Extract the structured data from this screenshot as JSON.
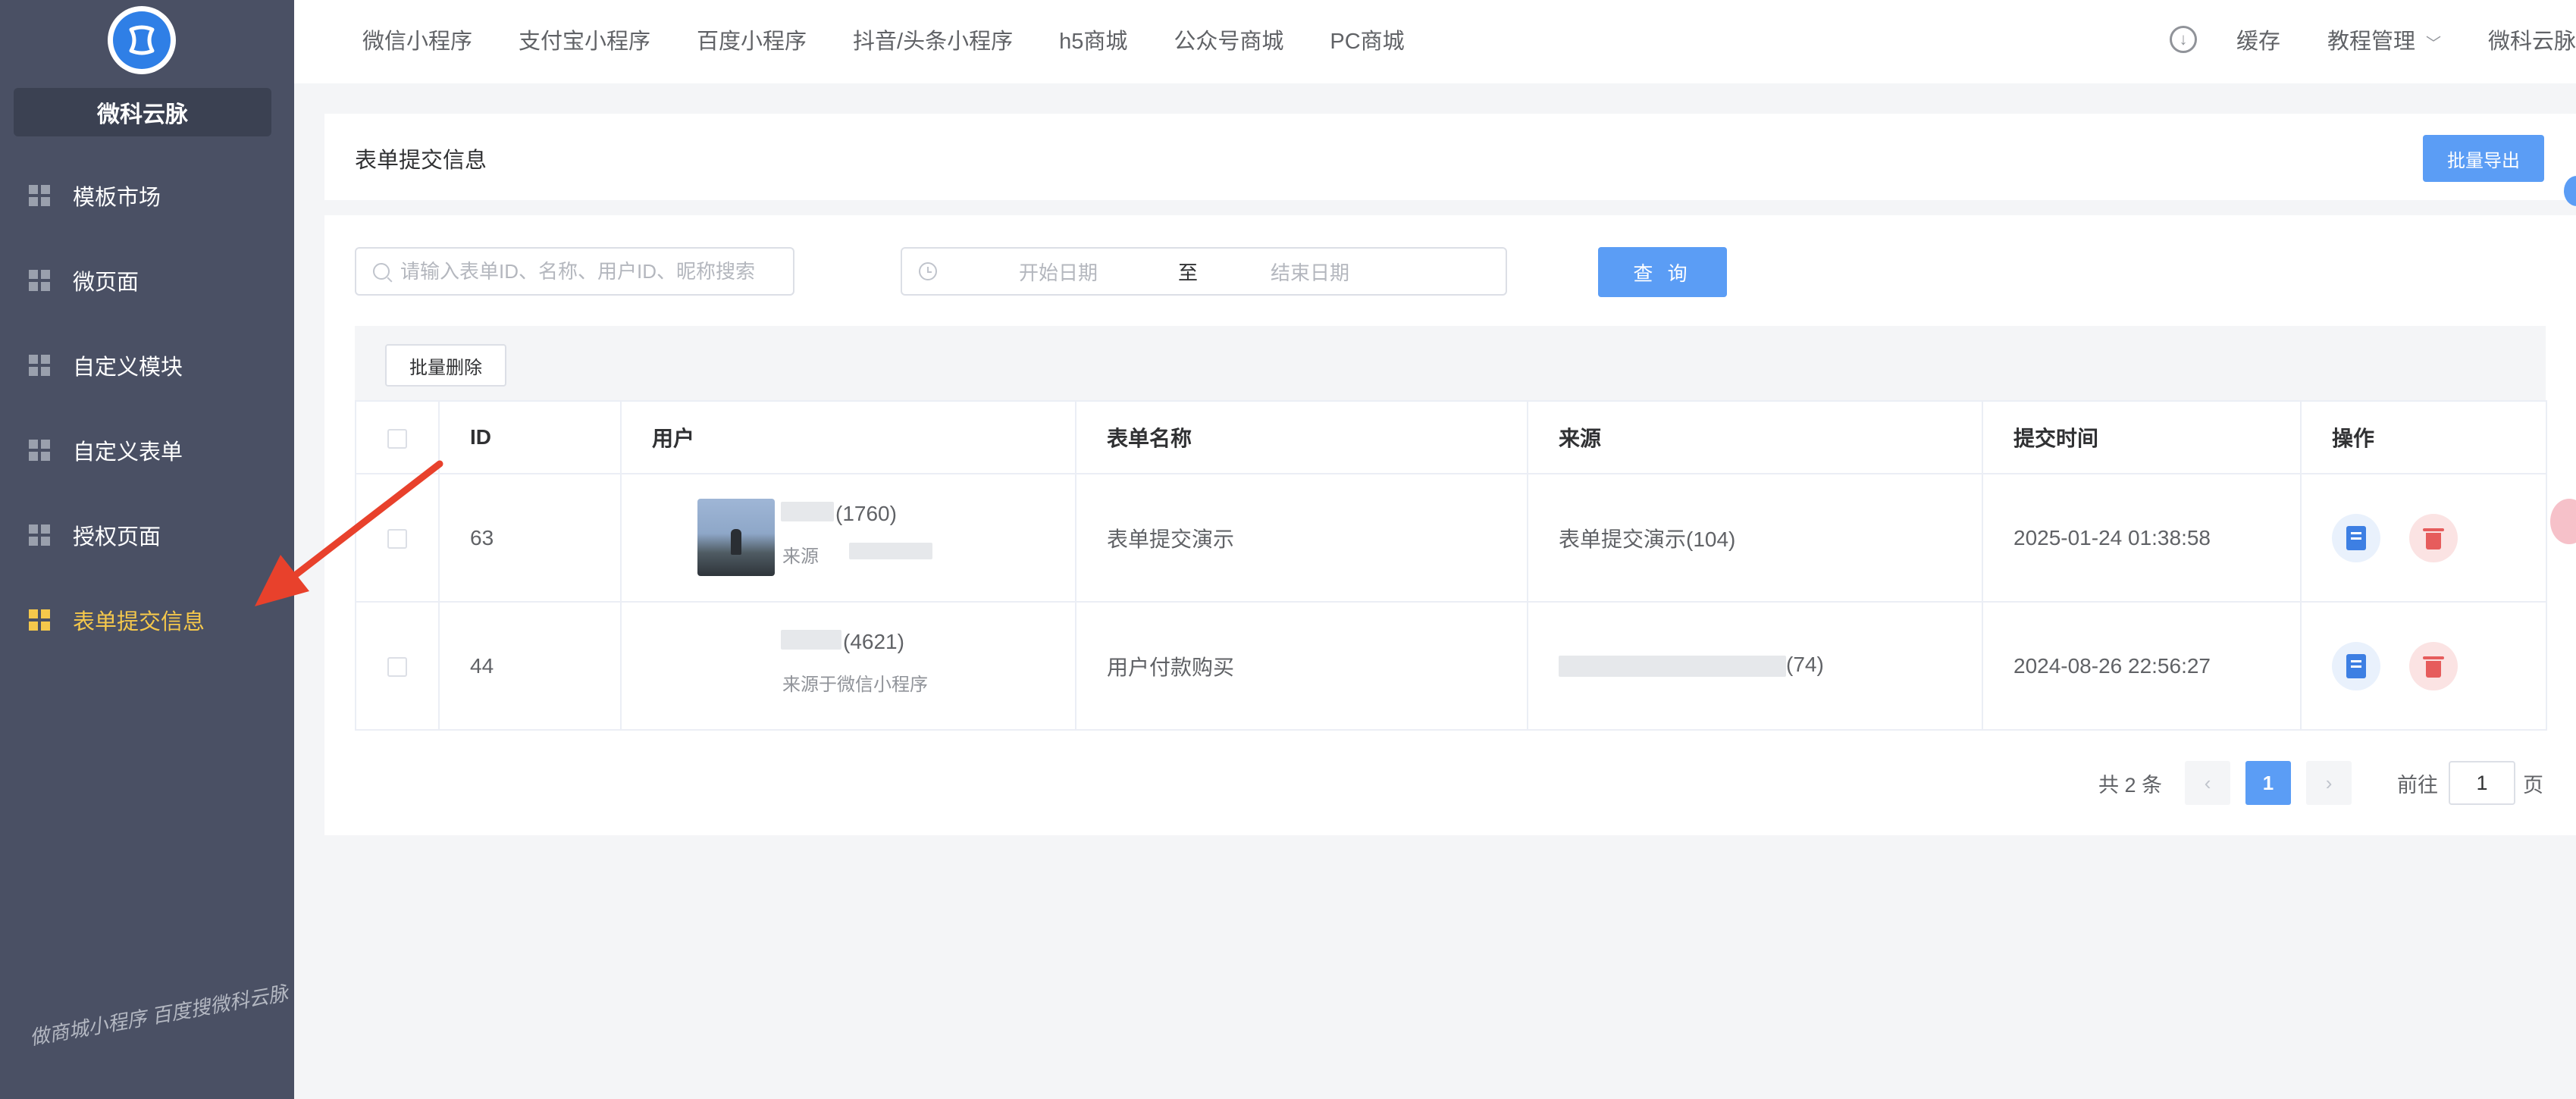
{
  "sidebar": {
    "brand": "微科云脉",
    "items": [
      {
        "label": "模板市场",
        "icon": "grid-icon"
      },
      {
        "label": "微页面",
        "icon": "grid-icon"
      },
      {
        "label": "自定义模块",
        "icon": "grid-icon"
      },
      {
        "label": "自定义表单",
        "icon": "grid-icon"
      },
      {
        "label": "授权页面",
        "icon": "grid-icon"
      },
      {
        "label": "表单提交信息",
        "icon": "grid-icon",
        "active": true
      }
    ],
    "watermark": "做商城小程序 百度搜微科云脉"
  },
  "topnav": {
    "items": [
      "微信小程序",
      "支付宝小程序",
      "百度小程序",
      "抖音/头条小程序",
      "h5商城",
      "公众号商城",
      "PC商城"
    ],
    "right": {
      "cache": "缓存",
      "tutorial": "教程管理",
      "user": "微科云脉"
    }
  },
  "page": {
    "title": "表单提交信息",
    "export_button": "批量导出"
  },
  "filters": {
    "search_placeholder": "请输入表单ID、名称、用户ID、昵称搜索",
    "date_start_placeholder": "开始日期",
    "date_separator": "至",
    "date_end_placeholder": "结束日期",
    "query_button": "查 询",
    "bulk_delete_button": "批量删除"
  },
  "table": {
    "headers": [
      "ID",
      "用户",
      "表单名称",
      "来源",
      "提交时间",
      "操作"
    ],
    "rows": [
      {
        "id": "63",
        "user_line1": "(1760)",
        "user_line2": "来源",
        "form_name": "表单提交演示",
        "source": "表单提交演示(104)",
        "time": "2025-01-24 01:38:58"
      },
      {
        "id": "44",
        "user_line1": "(4621)",
        "user_line2": "来源于微信小程序",
        "form_name": "用户付款购买",
        "source": "(74)",
        "time": "2024-08-26 22:56:27"
      }
    ]
  },
  "pagination": {
    "total": "共 2 条",
    "current": "1",
    "goto_prefix": "前往",
    "goto_value": "1",
    "goto_suffix": "页",
    "prev": "‹",
    "next": "›"
  },
  "colors": {
    "sidebar_bg": "#4a5064",
    "active": "#f5c84b",
    "primary": "#5b9df5",
    "danger": "#e65c5c",
    "arrow": "#e8412c"
  }
}
